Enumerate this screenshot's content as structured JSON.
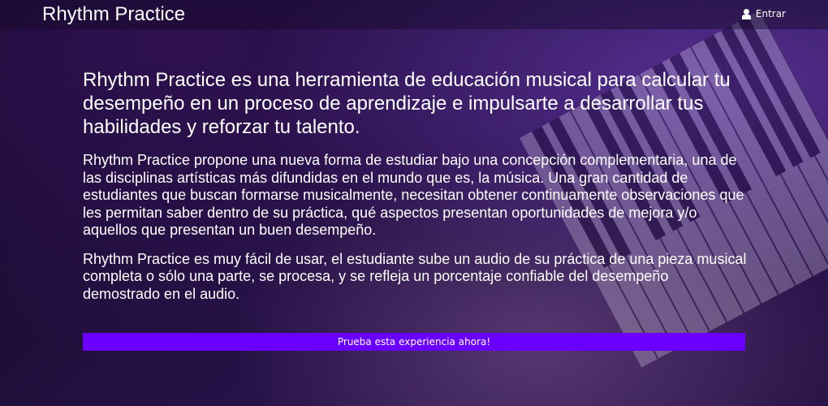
{
  "header": {
    "brand": "Rhythm Practice",
    "login_label": "Entrar",
    "login_icon": "user-icon"
  },
  "main": {
    "headline": "Rhythm Practice es una herramienta de educación musical para calcular tu desempeño en un proceso de aprendizaje e impulsarte a desarrollar tus habilidades y reforzar tu talento.",
    "paragraph1": "Rhythm Practice propone una nueva forma de estudiar bajo una concepción complementaria, una de las disciplinas artísticas más difundidas en el mundo que es, la música. Una gran cantidad de estudiantes que buscan formarse musicalmente, necesitan obtener continuamente observaciones que les permitan saber dentro de su práctica, qué aspectos presentan oportunidades de mejora y/o aquellos que presentan un buen desempeño.",
    "paragraph2": "Rhythm Practice es muy fácil de usar, el estudiante sube un audio de su práctica de una pieza musical completa o sólo una parte, se procesa, y se refleja un porcentaje confiable del desempeño demostrado en el audio.",
    "cta_label": "Prueba esta experiencia ahora!"
  },
  "colors": {
    "accent": "#6a00ff",
    "background": "#1a0a30",
    "text": "#ffffff"
  }
}
